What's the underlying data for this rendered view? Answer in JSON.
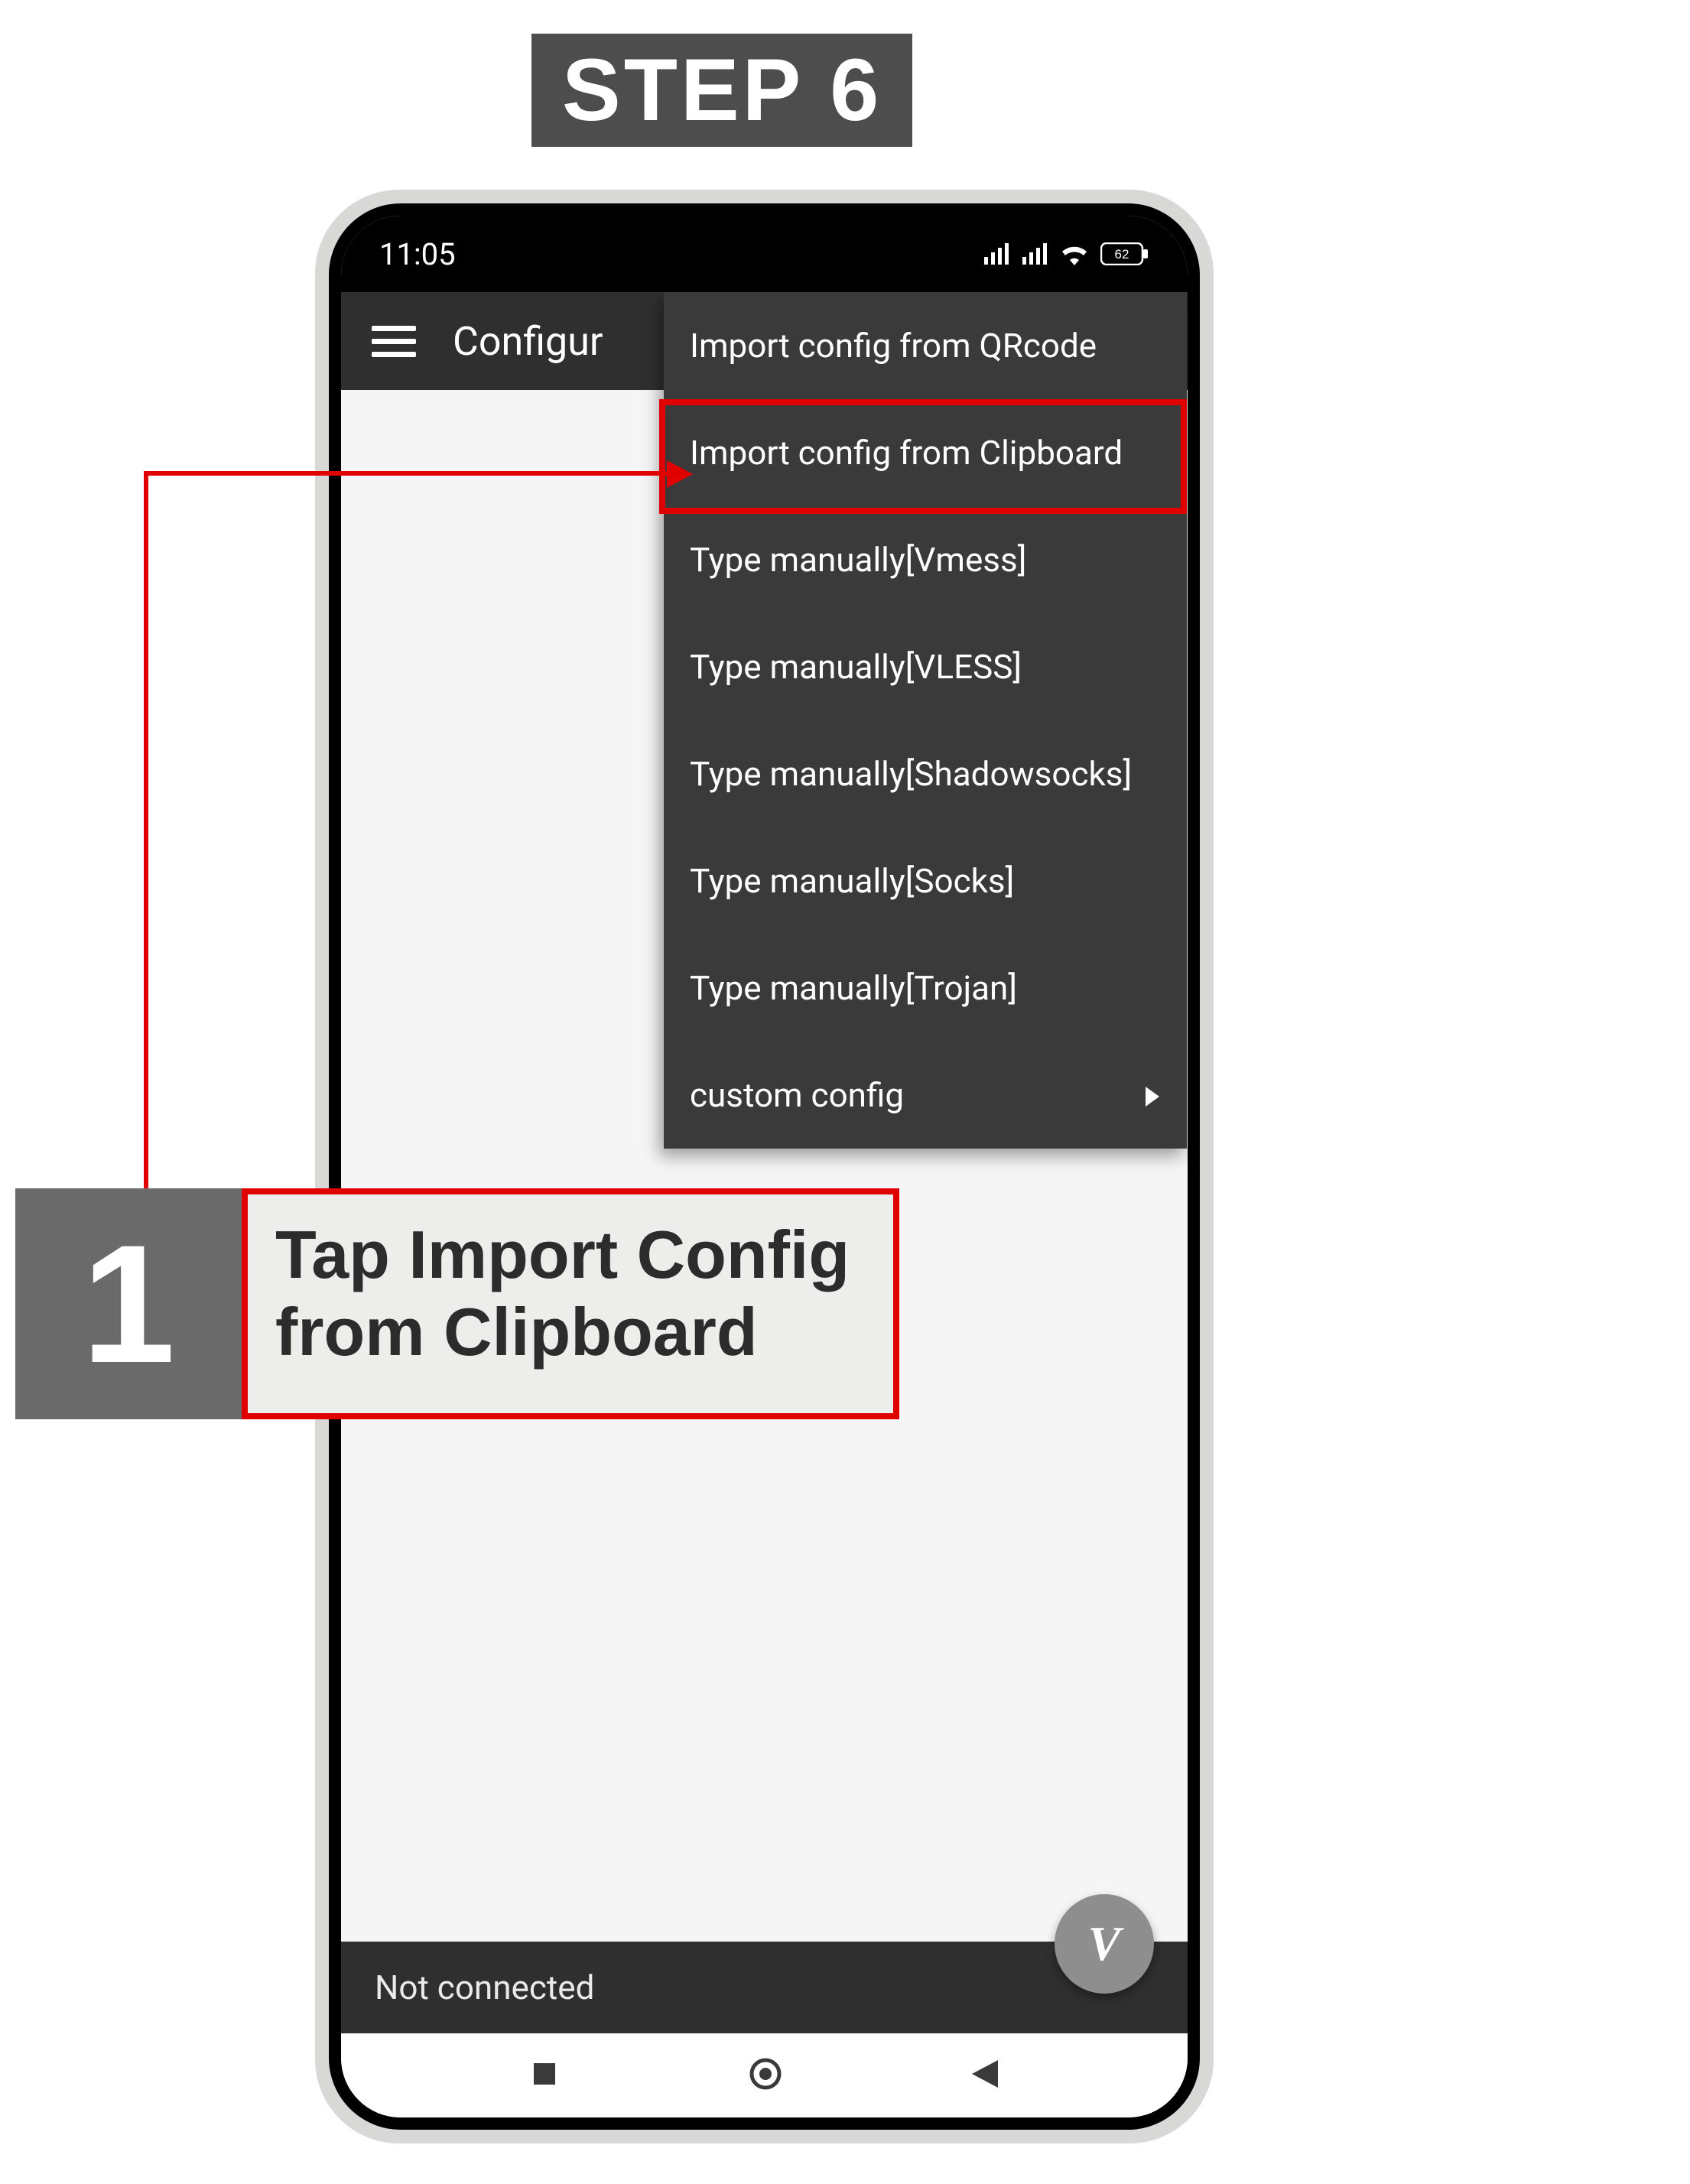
{
  "step_label": "STEP 6",
  "status": {
    "time": "11:05",
    "battery": "62"
  },
  "app_bar": {
    "title": "Configur"
  },
  "menu": {
    "items": [
      {
        "label": "Import config from QRcode",
        "has_submenu": false
      },
      {
        "label": "Import config from Clipboard",
        "has_submenu": false,
        "highlighted": true
      },
      {
        "label": "Type manually[Vmess]",
        "has_submenu": false
      },
      {
        "label": "Type manually[VLESS]",
        "has_submenu": false
      },
      {
        "label": "Type manually[Shadowsocks]",
        "has_submenu": false
      },
      {
        "label": "Type manually[Socks]",
        "has_submenu": false
      },
      {
        "label": "Type manually[Trojan]",
        "has_submenu": false
      },
      {
        "label": "custom config",
        "has_submenu": true
      }
    ]
  },
  "footer": {
    "status_text": "Not connected"
  },
  "fab": {
    "glyph": "V"
  },
  "callout": {
    "number": "1",
    "text": "Tap Import Config from Clipboard"
  },
  "colors": {
    "accent_red": "#e10000",
    "dark_gray": "#4d4d4d",
    "menu_bg": "#3a3a3a",
    "appbar_bg": "#2f2f2f"
  }
}
